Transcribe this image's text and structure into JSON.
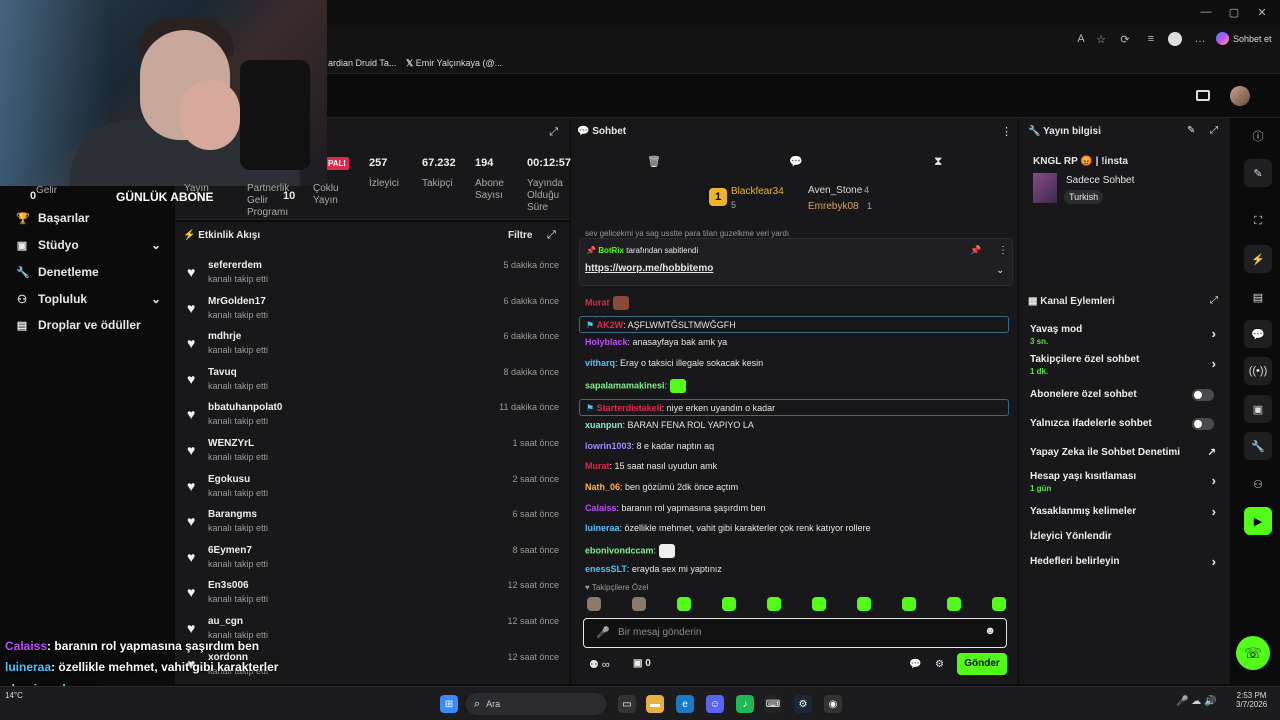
{
  "browser": {
    "copilot_label": "Sohbet et",
    "bookmarks": [
      "ardian Druid Ta...",
      "Emir Yalçınkaya (@..."
    ]
  },
  "stats": {
    "left_label_gelir": "Gelir",
    "left_count": "0",
    "gunluk_abone": "GÜNLÜK ABONE",
    "yayin": "Yayın",
    "partnerlik_lines": [
      "Partnerlik",
      "Gelir",
      "Programı"
    ],
    "partnerlik_count": "10",
    "coklu": [
      "Çoklu",
      "Yayın"
    ],
    "pali_badge": "PALI",
    "viewers": "257",
    "viewers_label": "İzleyici",
    "followers": "67.232",
    "followers_label": "Takipçi",
    "subs": "194",
    "subs_label": [
      "Abone",
      "Sayısı"
    ],
    "uptime": "00:12:57",
    "uptime_label": [
      "Yayında",
      "Olduğu",
      "Süre"
    ]
  },
  "nav": {
    "items": [
      {
        "label": "Başarılar",
        "icon": "trophy-icon"
      },
      {
        "label": "Stüdyo",
        "icon": "studio-icon",
        "chevron": true
      },
      {
        "label": "Denetleme",
        "icon": "wrench-icon"
      },
      {
        "label": "Topluluk",
        "icon": "community-icon",
        "chevron": true
      },
      {
        "label": "Droplar ve ödüller",
        "icon": "drops-icon"
      }
    ]
  },
  "events": {
    "title": "Etkinlik Akışı",
    "filter": "Filtre",
    "items": [
      {
        "name": "sefererdem",
        "sub": "kanalı takip etti",
        "time": "5 dakika önce"
      },
      {
        "name": "MrGolden17",
        "sub": "kanalı takip etti",
        "time": "6 dakika önce"
      },
      {
        "name": "mdhrje",
        "sub": "kanalı takip etti",
        "time": "6 dakika önce"
      },
      {
        "name": "Tavuq",
        "sub": "kanalı takip etti",
        "time": "8 dakika önce"
      },
      {
        "name": "bbatuhanpolat0",
        "sub": "kanalı takip etti",
        "time": "11 dakika önce"
      },
      {
        "name": "WENZYrL",
        "sub": "kanalı takip etti",
        "time": "1 saat önce"
      },
      {
        "name": "Egokusu",
        "sub": "kanalı takip etti",
        "time": "2 saat önce"
      },
      {
        "name": "Barangms",
        "sub": "kanalı takip etti",
        "time": "6 saat önce"
      },
      {
        "name": "6Eymen7",
        "sub": "kanalı takip etti",
        "time": "8 saat önce"
      },
      {
        "name": "En3s006",
        "sub": "kanalı takip etti",
        "time": "12 saat önce"
      },
      {
        "name": "au_cgn",
        "sub": "kanalı takip etti",
        "time": "12 saat önce"
      },
      {
        "name": "xordonn",
        "sub": "kanalı takip etti",
        "time": "12 saat önce"
      }
    ]
  },
  "chat": {
    "title": "Sohbet",
    "top": [
      {
        "name": "Blackfear34",
        "count": "5"
      },
      {
        "name": "Aven_Stone",
        "count": "4"
      },
      {
        "name": "Emrebyk08",
        "count": "1"
      }
    ],
    "pinned_by": "tarafından sabitlendi",
    "pinned_user": "BotRix",
    "pinned_link": "https://worp.me/hobbitemo",
    "cutoff_line": "sev gelicekmi ya sag usstte para tilan guzelkme veri yardı",
    "messages": [
      {
        "user": "Murat",
        "text": "",
        "color": "#e0284a"
      },
      {
        "user": "AK2W",
        "text": ": AŞFLWMTĞSLTMWĞGFH",
        "color": "#e0284a"
      },
      {
        "user": "Holyblack",
        "text": ": anasayfaya bak amk ya",
        "color": "#c04cff"
      },
      {
        "user": "vitharq",
        "text": ": Eray o taksici illegale sokacak kesin",
        "color": "#4cc4ff"
      },
      {
        "user": "sapalamamakinesi",
        "text": ":",
        "color": "#7cf08a"
      },
      {
        "user": "Starterdistakeli",
        "text": ": niye erken uyandın o kadar",
        "color": "#e0284a"
      },
      {
        "user": "xuanpun",
        "text": ": BARAN FENA ROL YAPIYO LA",
        "color": "#7cf0d8"
      },
      {
        "user": "lowrin1003",
        "text": ": 8 e kadar naptın aq",
        "color": "#9a8cff"
      },
      {
        "user": "Murat",
        "text": ": 15 saat nasıl uyudun amk",
        "color": "#e0284a"
      },
      {
        "user": "Nath_06",
        "text": ": ben gözümü 2dk önce açtım",
        "color": "#ffb347"
      },
      {
        "user": "Calaiss",
        "text": ": baranın rol yapmasına şaşırdım ben",
        "color": "#c04cff"
      },
      {
        "user": "luineraa",
        "text": ": özellikle mehmet, vahit gibi karakterler çok renk katıyor rollere",
        "color": "#4cc4ff"
      },
      {
        "user": "ebonivondccam",
        "text": ":",
        "color": "#7cf08a"
      },
      {
        "user": "enessSLT",
        "text": ": erayda sex mi yaptınız",
        "color": "#4cc4ff"
      }
    ],
    "followers_only": "Takipçilere Özel",
    "input_placeholder": "Bir mesaj gönderin",
    "count_label": "0",
    "send": "Gönder"
  },
  "info": {
    "title": "Yayın bilgisi",
    "stream_title": "KNGL RP 😡 | !insta",
    "category": "Sadece Sohbet",
    "tag": "Turkish"
  },
  "channel": {
    "title": "Kanal Eylemleri",
    "rows": [
      {
        "label": "Yavaş mod",
        "sub": "3 sn.",
        "kind": "chevron"
      },
      {
        "label": "Takipçilere özel sohbet",
        "sub": "1 dk.",
        "kind": "chevron"
      },
      {
        "label": "Abonelere özel sohbet",
        "sub": "",
        "kind": "toggle"
      },
      {
        "label": "Yalnızca ifadelerle sohbet",
        "sub": "",
        "kind": "toggle"
      },
      {
        "label": "Yapay Zeka ile Sohbet Denetimi",
        "sub": "",
        "kind": "external"
      },
      {
        "label": "Hesap yaşı kısıtlaması",
        "sub": "1 gün",
        "kind": "chevron"
      },
      {
        "label": "Yasaklanmış kelimeler",
        "sub": "",
        "kind": "chevron"
      },
      {
        "label": "İzleyici Yönlendir",
        "sub": "",
        "kind": "none"
      },
      {
        "label": "Hedefleri belirleyin",
        "sub": "",
        "kind": "chevron"
      }
    ]
  },
  "overlay": [
    {
      "user": "Calaiss",
      "text": ": baranın rol yapmasına şaşırdım ben",
      "color": "#c04cff"
    },
    {
      "user": "luineraa",
      "text": ": özellikle mehmet, vahit gibi karakterler",
      "color": "#4cc4ff"
    },
    {
      "user": "ebonivondccam",
      "text": ":",
      "color": "#7cf08a"
    },
    {
      "user": "enessSLT",
      "text": ": erayda sex mi yaptınız",
      "color": "#4cc4ff"
    }
  ],
  "taskbar": {
    "search": "Ara",
    "weather": "14°C",
    "time": "2:53 PM",
    "date": "3/7/2026"
  },
  "colors": {
    "accent": "#53fc18",
    "panel": "#18181a"
  }
}
